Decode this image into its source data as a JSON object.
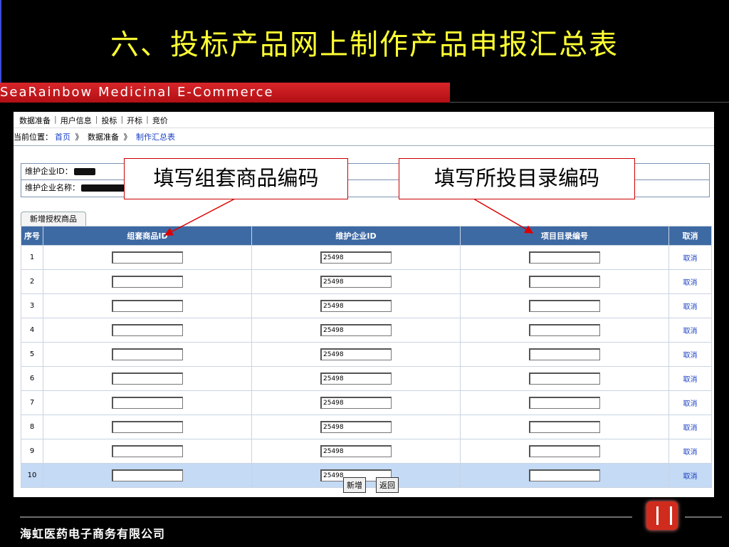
{
  "slide_title": "六、投标产品网上制作产品申报汇总表",
  "banner_text": "SeaRainbow Medicinal E-Commerce",
  "nav": {
    "items": [
      "数据准备",
      "用户信息",
      "投标",
      "开标",
      "竞价"
    ],
    "separator": "|"
  },
  "breadcrumb": {
    "label": "当前位置：",
    "home": "首页",
    "arrow": "》",
    "section": "数据准备",
    "current": "制作汇总表"
  },
  "info": {
    "enterprise_id_label": "维护企业ID：",
    "enterprise_name_label": "维护企业名称："
  },
  "tab_label": "新增授权商品",
  "table": {
    "headers": [
      "序号",
      "组套商品ID",
      "维护企业ID",
      "项目目录编号",
      "取消"
    ],
    "cancel_label": "取消",
    "enterprise_value": "25498",
    "rows": [
      "1",
      "2",
      "3",
      "4",
      "5",
      "6",
      "7",
      "8",
      "9",
      "10"
    ],
    "highlight_row": "10"
  },
  "buttons": {
    "add": "新增",
    "back": "返回"
  },
  "callouts": {
    "left": "填写组套商品编码",
    "right": "填写所投目录编码"
  },
  "footer_text": "海虹医药电子商务有限公司",
  "colors": {
    "title": "#ffff33",
    "banner": "#c81b20",
    "header": "#3e6aa3",
    "callout_border": "#cc0000"
  }
}
